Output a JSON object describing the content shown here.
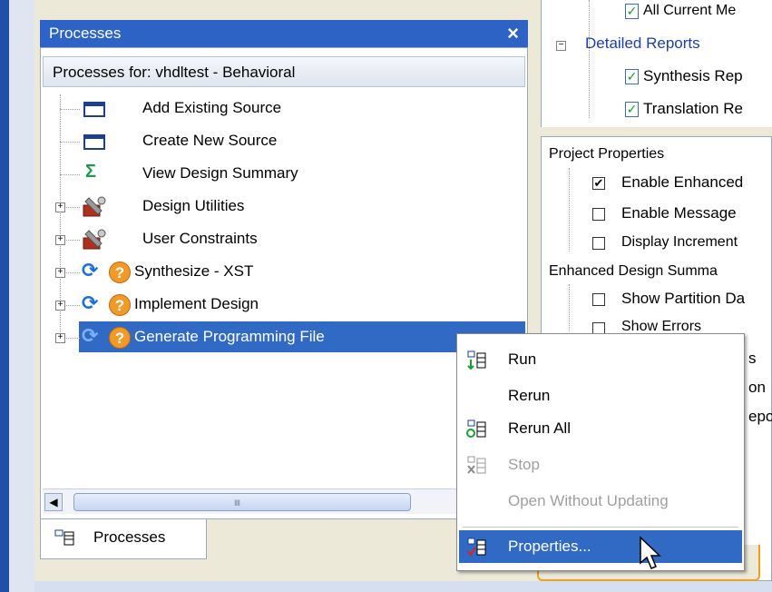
{
  "processes_panel": {
    "title": "Processes",
    "close_symbol": "×",
    "header": "Processes for: vhdltest - Behavioral",
    "items": [
      {
        "label": "Add Existing Source",
        "icon": "window-icon"
      },
      {
        "label": "Create New Source",
        "icon": "window-icon"
      },
      {
        "label": "View Design Summary",
        "icon": "sigma-icon"
      },
      {
        "label": "Design Utilities",
        "icon": "tools-icon",
        "expandable": true
      },
      {
        "label": "User Constraints",
        "icon": "tools-icon",
        "expandable": true
      },
      {
        "label": "Synthesize - XST",
        "icon": "refresh-question-icon",
        "expandable": true
      },
      {
        "label": "Implement Design",
        "icon": "refresh-question-icon",
        "expandable": true
      },
      {
        "label": "Generate Programming File",
        "icon": "refresh-question-icon",
        "expandable": true,
        "selected": true
      }
    ],
    "scroll_grip": "IIII",
    "tab_label": "Processes"
  },
  "right_top": {
    "items": [
      {
        "label": "All Current Me",
        "type": "report"
      },
      {
        "label": "Detailed Reports",
        "type": "folder"
      },
      {
        "label": "Synthesis Rep",
        "type": "report"
      },
      {
        "label": "Translation Re",
        "type": "report"
      }
    ]
  },
  "right_mid": {
    "section1": "Project Properties",
    "props1": [
      {
        "label": "Enable Enhanced",
        "checked": true
      },
      {
        "label": "Enable Message",
        "checked": false
      },
      {
        "label": "Display Increment",
        "checked": false
      }
    ],
    "section2": "Enhanced Design Summa",
    "props2": [
      {
        "label": "Show Partition Da",
        "checked": false
      },
      {
        "label": "Show Errors",
        "checked": false
      }
    ],
    "peek": [
      "s",
      "on",
      "epo"
    ]
  },
  "context_menu": {
    "items": [
      {
        "label": "Run",
        "enabled": true,
        "icon": "run-icon"
      },
      {
        "label": "Rerun",
        "enabled": true,
        "icon": ""
      },
      {
        "label": "Rerun All",
        "enabled": true,
        "icon": "rerun-all-icon"
      },
      {
        "label": "Stop",
        "enabled": false,
        "icon": "stop-icon"
      },
      {
        "label": "Open Without Updating",
        "enabled": false,
        "icon": ""
      },
      {
        "label": "Properties...",
        "enabled": true,
        "icon": "properties-icon",
        "highlighted": true
      }
    ]
  },
  "colors": {
    "titlebar": "#2e63c6",
    "selection": "#316ac5",
    "link": "#1c3fb0",
    "check_green": "#11a02b",
    "question_orange": "#f29a28"
  }
}
